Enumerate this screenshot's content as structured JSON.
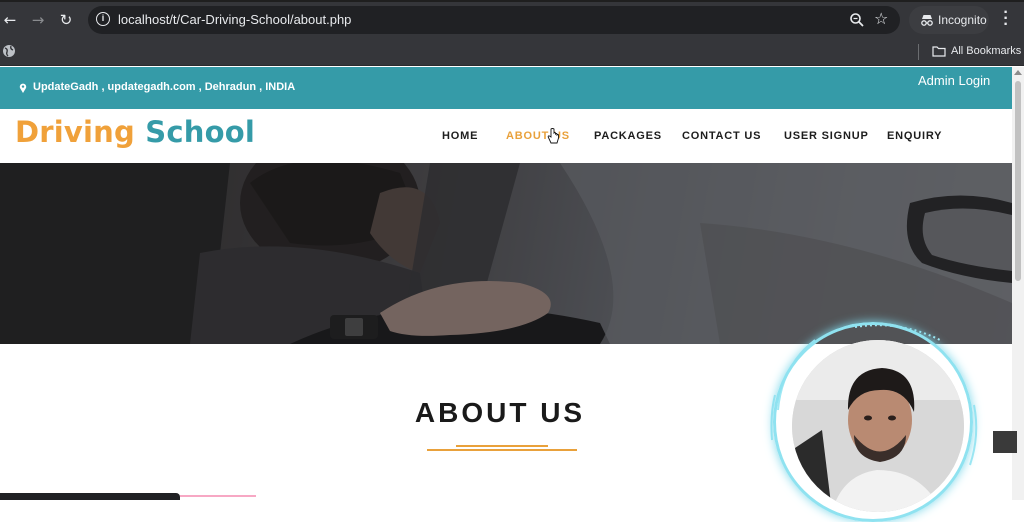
{
  "browser": {
    "url_host": "localhost",
    "url_path": "/t/Car-Driving-School/about.php",
    "incognito_label": "Incognito",
    "all_bookmarks_label": "All Bookmarks"
  },
  "site": {
    "topbar_info": "UpdateGadh , updategadh.com , Dehradun , INDIA",
    "admin_login": "Admin Login",
    "logo_word1": "Driving",
    "logo_word2": "School",
    "nav": {
      "home": "HOME",
      "about": "ABOUT US",
      "packages": "PACKAGES",
      "contact": "CONTACT US",
      "signup": "USER SIGNUP",
      "enquiry": "ENQUIRY"
    },
    "section_title": "ABOUT US"
  },
  "colors": {
    "topbar": "#359ba8",
    "accent_orange": "#f0a13a",
    "brand_teal": "#359ba8"
  }
}
